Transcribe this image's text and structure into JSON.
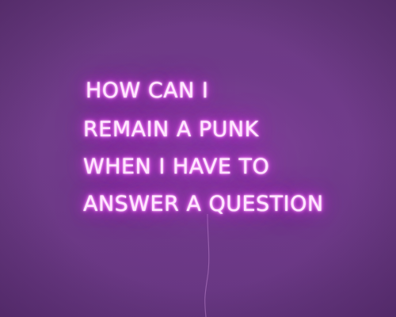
{
  "sign": {
    "lines": [
      "HOW CAN I",
      "REMAIN A PUNK",
      "WHEN I HAVE TO",
      "ANSWER A QUESTION"
    ],
    "neon_color": "#e040f0",
    "wall_color": "#6d3c86"
  }
}
